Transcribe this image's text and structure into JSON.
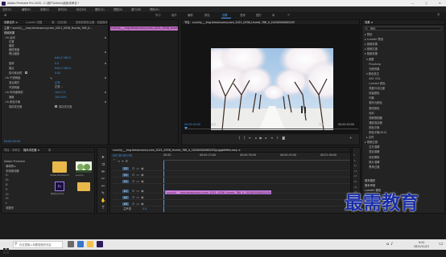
{
  "window": {
    "title": "Adobe Premiere Pro 2020 - C:\\用户\\Admin\\桌面\\未命名 *",
    "controls": [
      "—",
      "□",
      "✕"
    ]
  },
  "menu": [
    "文件(F)",
    "编辑(E)",
    "剪辑(C)",
    "序列(S)",
    "标记(M)",
    "图形(G)",
    "视图(V)",
    "窗口(W)",
    "帮助(H)"
  ],
  "workspaces": {
    "items": [
      "学习",
      "组件",
      "编辑",
      "颜色",
      "效果",
      "音频",
      "图形",
      "库"
    ],
    "active": "效果"
  },
  "effect_controls": {
    "tabs": [
      "效果控件 ≡",
      "Lumetri 范围",
      "源：(无剪辑)",
      "音频剪辑混合器：卓越森林"
    ],
    "header": "主要 * sunnily___img.lemonsunny.com_2021_0556_thumb_768_0...",
    "section_video": "视频效果",
    "rows": [
      {
        "label": "fx 运动"
      },
      {
        "label": "位置",
        "value": "640.0  360.0"
      },
      {
        "label": "缩放",
        "value": "100.0"
      },
      {
        "label": "缩放宽度",
        "value": "100.0"
      },
      {
        "label": "等比缩放"
      },
      {
        "label": "旋转",
        "value": "0.0"
      },
      {
        "label": "锚点",
        "value": "640.0  360.0"
      },
      {
        "label": "防闪烁滤镜",
        "value": "0.00"
      },
      {
        "label": "fx 不透明度"
      },
      {
        "label": "混合模式",
        "value": "正常"
      },
      {
        "label": "不透明度",
        "value": "100.0 %"
      },
      {
        "label": "fx 时间重映射"
      },
      {
        "label": "速度",
        "value": "100.00%"
      },
      {
        "label": "fx 颜色平衡"
      },
      {
        "label": "保持发光度"
      }
    ],
    "blend_dropdown": "正常",
    "checkbox_label": "保持发光度",
    "timecode": "00:00:00:00"
  },
  "clip_strip": {
    "name": "sunnily___img.lemonsunny.com_2021_0556_thumb_768_0"
  },
  "program": {
    "tab": "节目：sunnily___img.lemonsunny.com_2021_0556_thumb_768_0_20200500060203",
    "timecode_left": "00:00:00:00",
    "fit": "适合",
    "quality": "完整",
    "timecode_right": "00:00:05:00"
  },
  "effects_panel": {
    "tab": "效果 ≡",
    "search_placeholder": "颜色",
    "items": [
      "▸ 预设",
      "▸ Lumetri 预设",
      "▸ 音频效果",
      "▸ 音频过渡",
      "▾ 视频效果",
      "  ▾ 调整",
      "     ProcAmp",
      "     光照效果",
      "  ▾ 颜色校正",
      "     ASC CDL",
      "     Lumetri 颜色",
      "     亮度与对比度",
      "     保留颜色",
      "     均衡",
      "     更改为颜色",
      "     更改颜色",
      "     色彩",
      "     视频限制器",
      "     通道混合器",
      "     颜色平衡",
      "     颜色平衡(HLS)",
      "  ▸ 过时",
      "▸ 视频过渡",
      "     交叉溶解",
      "     叠加溶解",
      "     渐变擦除",
      "     胶片溶解",
      "     黑场过渡"
    ],
    "bottom": [
      "基本图形",
      "基本声音",
      "Lumetri 颜色",
      "库",
      "标记",
      "历史记录",
      "信息"
    ]
  },
  "project": {
    "tabs": [
      "项目：未命名",
      "媒体浏览器 ≡",
      "库"
    ],
    "tree": [
      "Adobe Premiere",
      "  局域网 ▸",
      "  本地驱动器",
      "  C:",
      "  D:",
      "  E:",
      "  F:",
      "  G:",
      "  H:",
      "  I:",
      "  收藏夹"
    ],
    "files": [
      {
        "label": "Adobe Premiere Pro Auto-Save",
        "type": "folder"
      },
      {
        "label": "sunnily...",
        "type": "image"
      },
      {
        "label": "未命名.prproj",
        "type": "premiere"
      },
      {
        "label": "",
        "type": "folder"
      }
    ]
  },
  "timeline": {
    "tab": "sunnily___img.lemonsunny.com_2021_0556_thumb_768_0_20200500060203(p)ggbfeffav.wcp ≡",
    "timecode": "00:00:00:00",
    "ruler": [
      "00:00",
      "00:00:15:00",
      "00:00:30:00",
      "00:00:45:00",
      "00:01:00:00"
    ],
    "tracks": [
      "V3",
      "V2",
      "V1",
      "A1",
      "A2",
      "A3"
    ],
    "master": "主声道",
    "master_value": "0.0",
    "clip_label": "sunnily___img.lemonsunny.com_2021_0556_thumb_768_0_20200500060203(p)ggbfeffav.jpg"
  },
  "meter_scale": [
    "0",
    "-6",
    "-12",
    "-18",
    "-24",
    "-30",
    "-36",
    "-42",
    "-48",
    "-54",
    "dB"
  ],
  "taskbar": {
    "search_placeholder": "在这里输入你要搜索的内容",
    "time": "9:41",
    "date": "2021/11/12"
  },
  "watermark": "最需教育",
  "colors": {
    "accent": "#4a9cf3",
    "clip_pink": "#d787d4",
    "clip_purple": "#a76bd8",
    "timecode_blue": "#3b8fdc"
  }
}
